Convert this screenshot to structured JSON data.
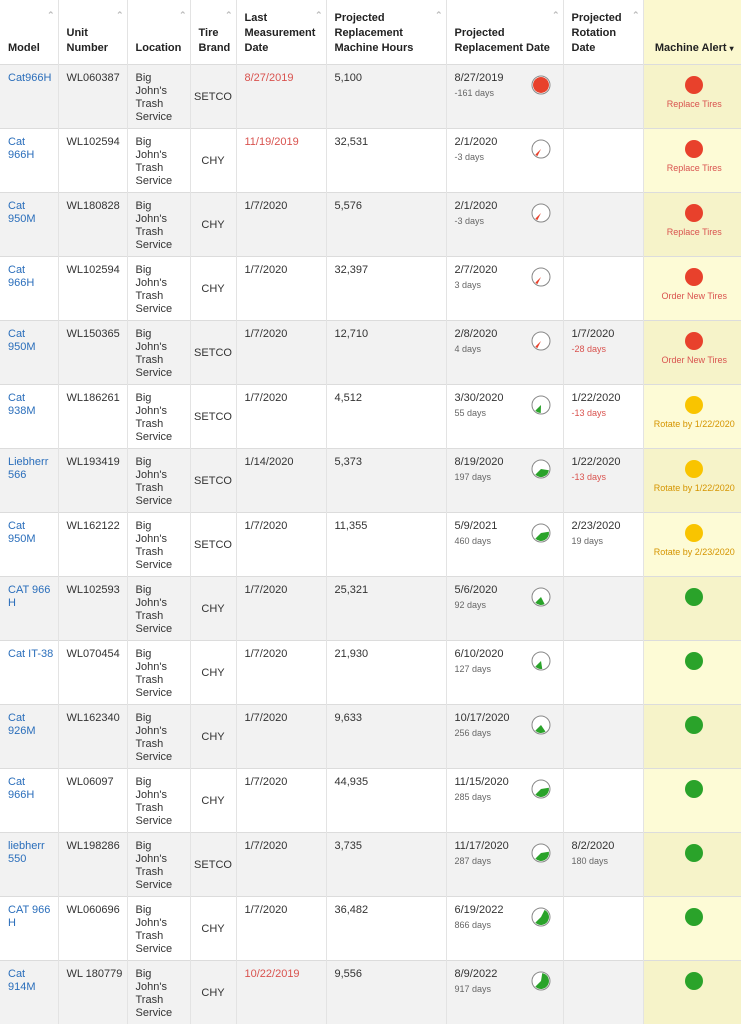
{
  "columns": {
    "model": "Model",
    "unit": "Unit Number",
    "location": "Location",
    "brand": "Tire Brand",
    "last": "Last Measurement Date",
    "hours": "Projected Replacement Machine Hours",
    "replace_date": "Projected Replacement Date",
    "rotation": "Projected Rotation Date",
    "alert": "Machine Alert"
  },
  "colors": {
    "red": "#e8412c",
    "yellow": "#f9c400",
    "green": "#2aa32a"
  },
  "rows": [
    {
      "model": "Cat966H",
      "unit": "WL060387",
      "location": "Big John's Trash Service",
      "brand": "SETCO",
      "last": "8/27/2019",
      "last_red": true,
      "hours": "5,100",
      "replace_date": "8/27/2019",
      "replace_sub": "-161 days",
      "gauge": 1.0,
      "gauge_color": "red",
      "rotation": "",
      "rotation_sub": "",
      "rotation_sub_red": false,
      "alert": "red",
      "alert_label": "Replace Tires"
    },
    {
      "model": "Cat 966H",
      "unit": "WL102594",
      "location": "Big John's Trash Service",
      "brand": "CHY",
      "last": "11/19/2019",
      "last_red": true,
      "hours": "32,531",
      "replace_date": "2/1/2020",
      "replace_sub": "-3 days",
      "gauge": 0.05,
      "gauge_color": "red",
      "rotation": "",
      "rotation_sub": "",
      "rotation_sub_red": false,
      "alert": "red",
      "alert_label": "Replace Tires"
    },
    {
      "model": "Cat 950M",
      "unit": "WL180828",
      "location": "Big John's Trash Service",
      "brand": "CHY",
      "last": "1/7/2020",
      "last_red": false,
      "hours": "5,576",
      "replace_date": "2/1/2020",
      "replace_sub": "-3 days",
      "gauge": 0.05,
      "gauge_color": "red",
      "rotation": "",
      "rotation_sub": "",
      "rotation_sub_red": false,
      "alert": "red",
      "alert_label": "Replace Tires"
    },
    {
      "model": "Cat 966H",
      "unit": "WL102594",
      "location": "Big John's Trash Service",
      "brand": "CHY",
      "last": "1/7/2020",
      "last_red": false,
      "hours": "32,397",
      "replace_date": "2/7/2020",
      "replace_sub": "3 days",
      "gauge": 0.05,
      "gauge_color": "red",
      "rotation": "",
      "rotation_sub": "",
      "rotation_sub_red": false,
      "alert": "red",
      "alert_label": "Order New Tires"
    },
    {
      "model": "Cat 950M",
      "unit": "WL150365",
      "location": "Big John's Trash Service",
      "brand": "SETCO",
      "last": "1/7/2020",
      "last_red": false,
      "hours": "12,710",
      "replace_date": "2/8/2020",
      "replace_sub": "4 days",
      "gauge": 0.05,
      "gauge_color": "red",
      "rotation": "1/7/2020",
      "rotation_sub": "-28 days",
      "rotation_sub_red": true,
      "alert": "red",
      "alert_label": "Order New Tires"
    },
    {
      "model": "Cat 938M",
      "unit": "WL186261",
      "location": "Big John's Trash Service",
      "brand": "SETCO",
      "last": "1/7/2020",
      "last_red": false,
      "hours": "4,512",
      "replace_date": "3/30/2020",
      "replace_sub": "55 days",
      "gauge": 0.12,
      "gauge_color": "green",
      "rotation": "1/22/2020",
      "rotation_sub": "-13 days",
      "rotation_sub_red": true,
      "alert": "yellow",
      "alert_label": "Rotate by 1/22/2020"
    },
    {
      "model": "Liebherr 566",
      "unit": "WL193419",
      "location": "Big John's Trash Service",
      "brand": "SETCO",
      "last": "1/14/2020",
      "last_red": false,
      "hours": "5,373",
      "replace_date": "8/19/2020",
      "replace_sub": "197 days",
      "gauge": 0.35,
      "gauge_color": "green",
      "rotation": "1/22/2020",
      "rotation_sub": "-13 days",
      "rotation_sub_red": true,
      "alert": "yellow",
      "alert_label": "Rotate by 1/22/2020"
    },
    {
      "model": "Cat 950M",
      "unit": "WL162122",
      "location": "Big John's Trash Service",
      "brand": "SETCO",
      "last": "1/7/2020",
      "last_red": false,
      "hours": "11,355",
      "replace_date": "5/9/2021",
      "replace_sub": "460 days",
      "gauge": 0.4,
      "gauge_color": "green",
      "rotation": "2/23/2020",
      "rotation_sub": "19 days",
      "rotation_sub_red": false,
      "alert": "yellow",
      "alert_label": "Rotate by 2/23/2020"
    },
    {
      "model": "CAT 966 H",
      "unit": "WL102593",
      "location": "Big John's Trash Service",
      "brand": "CHY",
      "last": "1/7/2020",
      "last_red": false,
      "hours": "25,321",
      "replace_date": "5/6/2020",
      "replace_sub": "92 days",
      "gauge": 0.2,
      "gauge_color": "green",
      "rotation": "",
      "rotation_sub": "",
      "rotation_sub_red": false,
      "alert": "green",
      "alert_label": ""
    },
    {
      "model": "Cat IT-38",
      "unit": "WL070454",
      "location": "Big John's Trash Service",
      "brand": "CHY",
      "last": "1/7/2020",
      "last_red": false,
      "hours": "21,930",
      "replace_date": "6/10/2020",
      "replace_sub": "127 days",
      "gauge": 0.15,
      "gauge_color": "green",
      "rotation": "",
      "rotation_sub": "",
      "rotation_sub_red": false,
      "alert": "green",
      "alert_label": ""
    },
    {
      "model": "Cat 926M",
      "unit": "WL162340",
      "location": "Big John's Trash Service",
      "brand": "CHY",
      "last": "1/7/2020",
      "last_red": false,
      "hours": "9,633",
      "replace_date": "10/17/2020",
      "replace_sub": "256 days",
      "gauge": 0.22,
      "gauge_color": "green",
      "rotation": "",
      "rotation_sub": "",
      "rotation_sub_red": false,
      "alert": "green",
      "alert_label": ""
    },
    {
      "model": "Cat 966H",
      "unit": "WL06097",
      "location": "Big John's Trash Service",
      "brand": "CHY",
      "last": "1/7/2020",
      "last_red": false,
      "hours": "44,935",
      "replace_date": "11/15/2020",
      "replace_sub": "285 days",
      "gauge": 0.4,
      "gauge_color": "green",
      "rotation": "",
      "rotation_sub": "",
      "rotation_sub_red": false,
      "alert": "green",
      "alert_label": ""
    },
    {
      "model": "liebherr 550",
      "unit": "WL198286",
      "location": "Big John's Trash Service",
      "brand": "SETCO",
      "last": "1/7/2020",
      "last_red": false,
      "hours": "3,735",
      "replace_date": "11/17/2020",
      "replace_sub": "287 days",
      "gauge": 0.4,
      "gauge_color": "green",
      "rotation": "8/2/2020",
      "rotation_sub": "180 days",
      "rotation_sub_red": false,
      "alert": "green",
      "alert_label": ""
    },
    {
      "model": "CAT 966 H",
      "unit": "WL060696",
      "location": "Big John's Trash Service",
      "brand": "CHY",
      "last": "1/7/2020",
      "last_red": false,
      "hours": "36,482",
      "replace_date": "6/19/2022",
      "replace_sub": "866 days",
      "gauge": 0.55,
      "gauge_color": "green",
      "rotation": "",
      "rotation_sub": "",
      "rotation_sub_red": false,
      "alert": "green",
      "alert_label": ""
    },
    {
      "model": "Cat 914M",
      "unit": "WL 180779",
      "location": "Big John's Trash Service",
      "brand": "CHY",
      "last": "10/22/2019",
      "last_red": true,
      "hours": "9,556",
      "replace_date": "8/9/2022",
      "replace_sub": "917 days",
      "gauge": 0.6,
      "gauge_color": "green",
      "rotation": "",
      "rotation_sub": "",
      "rotation_sub_red": false,
      "alert": "green",
      "alert_label": ""
    }
  ]
}
